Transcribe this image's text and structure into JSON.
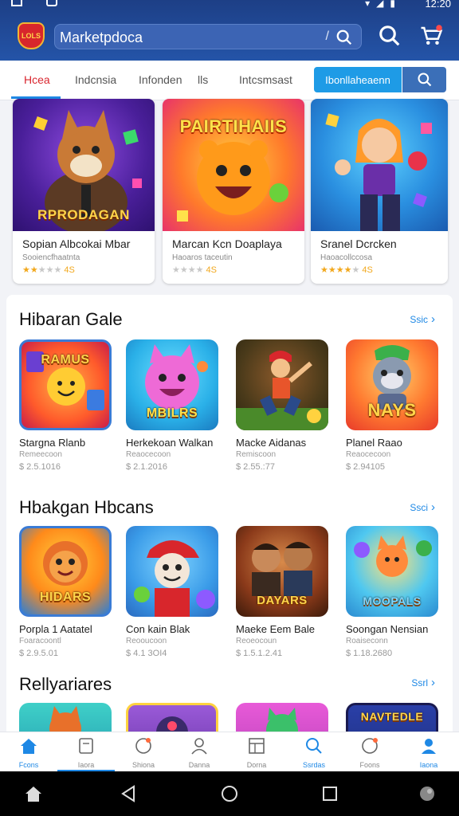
{
  "status_bar": {
    "time": "12:20",
    "icons": [
      "wifi-icon",
      "signal-icon",
      "battery-icon"
    ]
  },
  "header": {
    "search_text": "Marketpdoca",
    "search_divider": "/",
    "logo_text": "LOLS"
  },
  "tabs": [
    {
      "label": "Hcea",
      "active": true
    },
    {
      "label": "Indcnsia",
      "active": false
    },
    {
      "label": "Infonden",
      "active": false
    },
    {
      "label": "lls",
      "active": false
    },
    {
      "label": "Intcsmsast",
      "active": false
    }
  ],
  "cta_label": "Ibonllaheaenn",
  "featured": [
    {
      "banner": "RPRODAGAN",
      "title": "Sopian Albcokai Mbar",
      "subtitle": "Sooiencfhaatnta",
      "stars_filled": 2,
      "rating": "4S",
      "bg": "#5a2bb5"
    },
    {
      "banner": "PAIRTIHAIIS",
      "title": "Marcan Kcn Doaplaya",
      "subtitle": "Haoaros taceutin",
      "stars_filled": 1,
      "rating": "4S",
      "bg": "#ff5a3c"
    },
    {
      "banner": "",
      "title": "Sranel Dcrcken",
      "subtitle": "Haoacollccosa",
      "stars_filled": 4,
      "rating": "4S",
      "bg": "#2196e0"
    }
  ],
  "sections": [
    {
      "title": "Hibaran Gale",
      "see_all": "Ssic",
      "apps": [
        {
          "word": "RAMUS",
          "name": "Stargna Rlanb",
          "sub": "Remeecoon",
          "price": "$ 2.5.1016",
          "bg": "#ff6a2b"
        },
        {
          "word": "MBILRS",
          "name": "Herkekoan Walkan",
          "sub": "Reaocecoon",
          "price": "$ 2.1.2016",
          "bg": "#c64fd9"
        },
        {
          "word": "",
          "name": "Macke Aidanas",
          "sub": "Remiscoon",
          "price": "$ 2.55.:77",
          "bg": "#4a7a30"
        },
        {
          "word": "NAYS",
          "name": "Planel Raao",
          "sub": "Reaocecoon",
          "price": "$ 2.94105",
          "bg": "#ff5530"
        }
      ]
    },
    {
      "title": "Hbakgan Hbcans",
      "see_all": "Ssci",
      "apps": [
        {
          "word": "HIDARS",
          "name": "Porpla 1 Aatatel",
          "sub": "Foaracoontl",
          "price": "$ 2.9.5.01",
          "bg": "#1e7fd8"
        },
        {
          "word": "",
          "name": "Con kain Blak",
          "sub": "Reooucoon",
          "price": "$ 4.1 3OI4",
          "bg": "#2c8ae0"
        },
        {
          "word": "DAYARS",
          "name": "Maeke Eem Bale",
          "sub": "Reoeocoun",
          "price": "$ 1.5.1.2.41",
          "bg": "#8b3a1a"
        },
        {
          "word": "MOOPALS",
          "name": "Soongan Nensian",
          "sub": "Roaiseconn",
          "price": "$ 1.18.2680",
          "bg": "#30b0e0"
        }
      ]
    },
    {
      "title": "Rellyariares",
      "see_all": "Ssrl",
      "apps": [
        {
          "word": "",
          "name": "",
          "sub": "",
          "price": "",
          "bg": "#2bb5a8"
        },
        {
          "word": "",
          "name": "",
          "sub": "",
          "price": "",
          "bg": "#7a3fc0"
        },
        {
          "word": "",
          "name": "",
          "sub": "",
          "price": "",
          "bg": "#d44ad0"
        },
        {
          "word": "NAVTEDLE",
          "name": "",
          "sub": "",
          "price": "",
          "bg": "#2b3fa8"
        }
      ]
    }
  ],
  "bottom_nav": [
    {
      "label": "Fcons",
      "icon": "home-icon",
      "active": true
    },
    {
      "label": "Iaora",
      "icon": "book-icon",
      "active": false
    },
    {
      "label": "Shiona",
      "icon": "compass-icon",
      "active": false
    },
    {
      "label": "Danna",
      "icon": "person-icon",
      "active": false
    },
    {
      "label": "Dorna",
      "icon": "grid-icon",
      "active": false
    },
    {
      "label": "Ssrdas",
      "icon": "search-icon",
      "active": true
    },
    {
      "label": "Foons",
      "icon": "circle-icon",
      "active": false
    },
    {
      "label": "Iaona",
      "icon": "profile-icon",
      "active": true
    }
  ],
  "colors": {
    "header": "#1d3f86",
    "accent": "#1e88e5",
    "active_tab": "#d9262f",
    "star": "#f2a81d"
  }
}
